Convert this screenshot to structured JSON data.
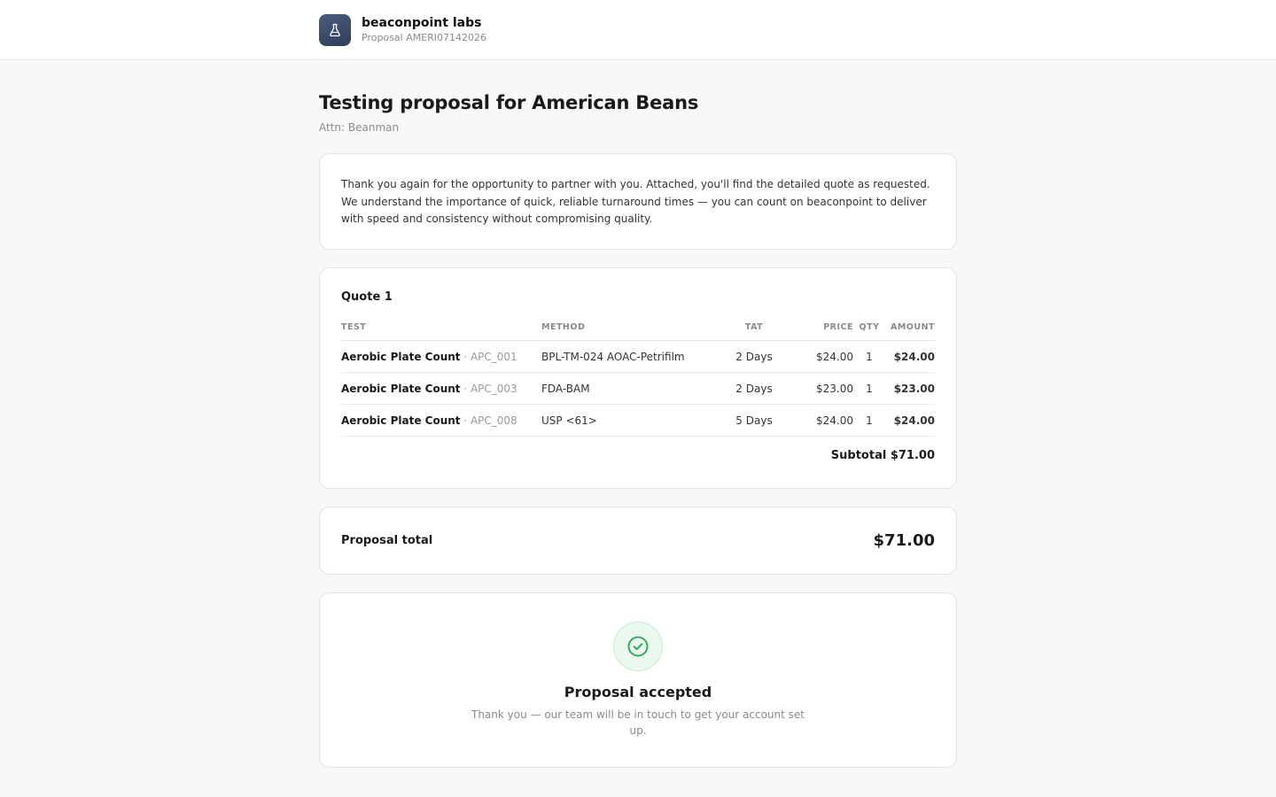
{
  "header": {
    "brand_name": "beaconpoint labs",
    "proposal_id": "Proposal AMERI07142026",
    "logo_icon": "flask-icon",
    "logo_color": "#3d4f6e"
  },
  "page": {
    "title": "Testing proposal for American Beans",
    "attn": "Attn: Beanman"
  },
  "intro": {
    "text": "Thank you again for the opportunity to partner with you. Attached, you'll find the detailed quote as requested. We understand the importance of quick, reliable turnaround times — you can count on beaconpoint to deliver with speed and consistency without compromising quality."
  },
  "quote": {
    "title": "Quote 1",
    "columns": {
      "test": "TEST",
      "method": "METHOD",
      "tat": "TAT",
      "price": "PRICE",
      "qty": "QTY",
      "amount": "AMOUNT"
    },
    "rows": [
      {
        "name": "Aerobic Plate Count",
        "code": " · APC_001",
        "method": "BPL-TM-024 AOAC-Petrifilm",
        "tat": "2 Days",
        "price": "$24.00",
        "qty": "1",
        "amount": "$24.00"
      },
      {
        "name": "Aerobic Plate Count",
        "code": " · APC_003",
        "method": "FDA-BAM",
        "tat": "2 Days",
        "price": "$23.00",
        "qty": "1",
        "amount": "$23.00"
      },
      {
        "name": "Aerobic Plate Count",
        "code": " · APC_008",
        "method": "USP <61>",
        "tat": "5 Days",
        "price": "$24.00",
        "qty": "1",
        "amount": "$24.00"
      }
    ],
    "subtotal": "Subtotal $71.00"
  },
  "total": {
    "label": "Proposal total",
    "value": "$71.00"
  },
  "accepted": {
    "icon": "check-circle-icon",
    "title": "Proposal accepted",
    "message": "Thank you — our team will be in touch to get your account set up.",
    "accent_color": "#22a652"
  }
}
